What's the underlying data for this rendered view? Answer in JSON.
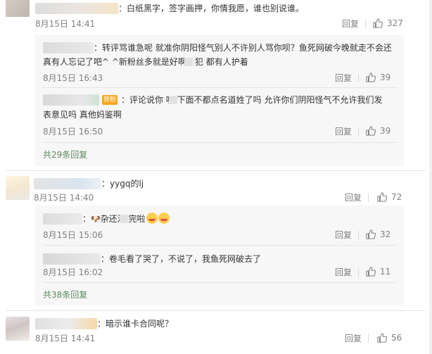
{
  "comments": [
    {
      "text": "：白纸黑字，签字画押，你情我愿，谁也别说谁。",
      "date": "8月15日 14:41",
      "reply_label": "回复",
      "likes": "327",
      "replies": [
        {
          "text_line1": "：转评骂谁急呢 就准你阴阳怪气别人不许别人骂你呗？鱼死网破今晚就走不会还",
          "text_line2": "真有人忘记了吧^ ^新粉丝多就是好啊，犯     都有人护着",
          "date": "8月15日 16:43",
          "reply_label": "回复",
          "likes": "39"
        },
        {
          "badge": "铁粉",
          "text_line1": "：评论说你     呢 下面不都点名道姓了吗 允许你们阴阳怪气不允许我们发",
          "text_line2": "表意见吗 真他妈鉴啊",
          "date": "8月15日 16:50",
          "reply_label": "回复",
          "likes": "39"
        }
      ],
      "more_replies": "共29条回复"
    },
    {
      "text": "：yygq的lj",
      "date": "8月15日 14:40",
      "reply_label": "回复",
      "likes": "72",
      "replies": [
        {
          "text_prefix": "：",
          "text": "杂还没     完啦",
          "date": "8月15日 15:06",
          "reply_label": "回复",
          "likes": "32"
        },
        {
          "text": "：卷毛看了哭了，不说了，我鱼死网破去了",
          "date": "8月15日 16:02",
          "reply_label": "回复",
          "likes": "11"
        }
      ],
      "more_replies": "共38条回复"
    },
    {
      "text": "：暗示谁卡合同呢？",
      "date": "8月15日 14:41",
      "reply_label": "回复",
      "likes": "56"
    }
  ],
  "icons": {
    "like": "thumbs-up-icon",
    "emoji": "smiling-face-emoji-icon",
    "dog": "dog-face-emoji-icon"
  },
  "colors": {
    "more_link": "#5d8a5e",
    "meta": "#808080",
    "badge": "#f5a623"
  }
}
